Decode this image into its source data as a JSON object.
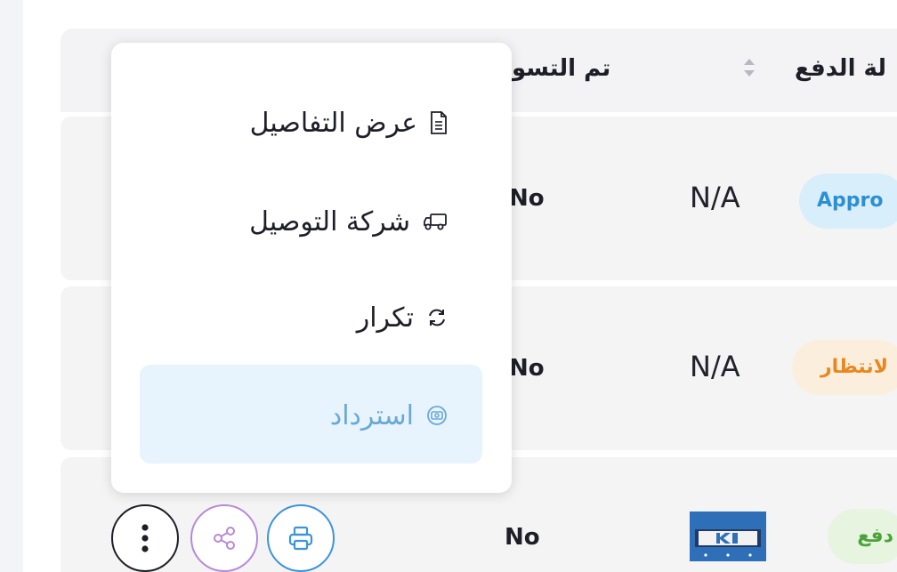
{
  "table": {
    "headers": {
      "settled": "تم التسو",
      "payment_status": "لة الدفع"
    },
    "rows": [
      {
        "settled": "No",
        "amount": "N/A",
        "status": "Appro"
      },
      {
        "settled": "No",
        "amount": "N/A",
        "status": "لانتظار"
      },
      {
        "settled": "No",
        "status": "دفع"
      }
    ]
  },
  "menu": {
    "items": [
      {
        "label": "عرض التفاصيل",
        "icon": "document-icon"
      },
      {
        "label": "شركة التوصيل",
        "icon": "truck-icon"
      },
      {
        "label": "تكرار",
        "icon": "refresh-icon"
      },
      {
        "label": "استرداد",
        "icon": "refund-icon"
      }
    ]
  },
  "colors": {
    "approved_bg": "#d9eefb",
    "approved_text": "#2d8fd2",
    "pending_bg": "#fbeedd",
    "pending_text": "#e8871d",
    "paid_bg": "#e6f4e0",
    "paid_text": "#4ca33a",
    "highlight_bg": "#e8f4fd",
    "highlight_text": "#6aa9d6"
  }
}
